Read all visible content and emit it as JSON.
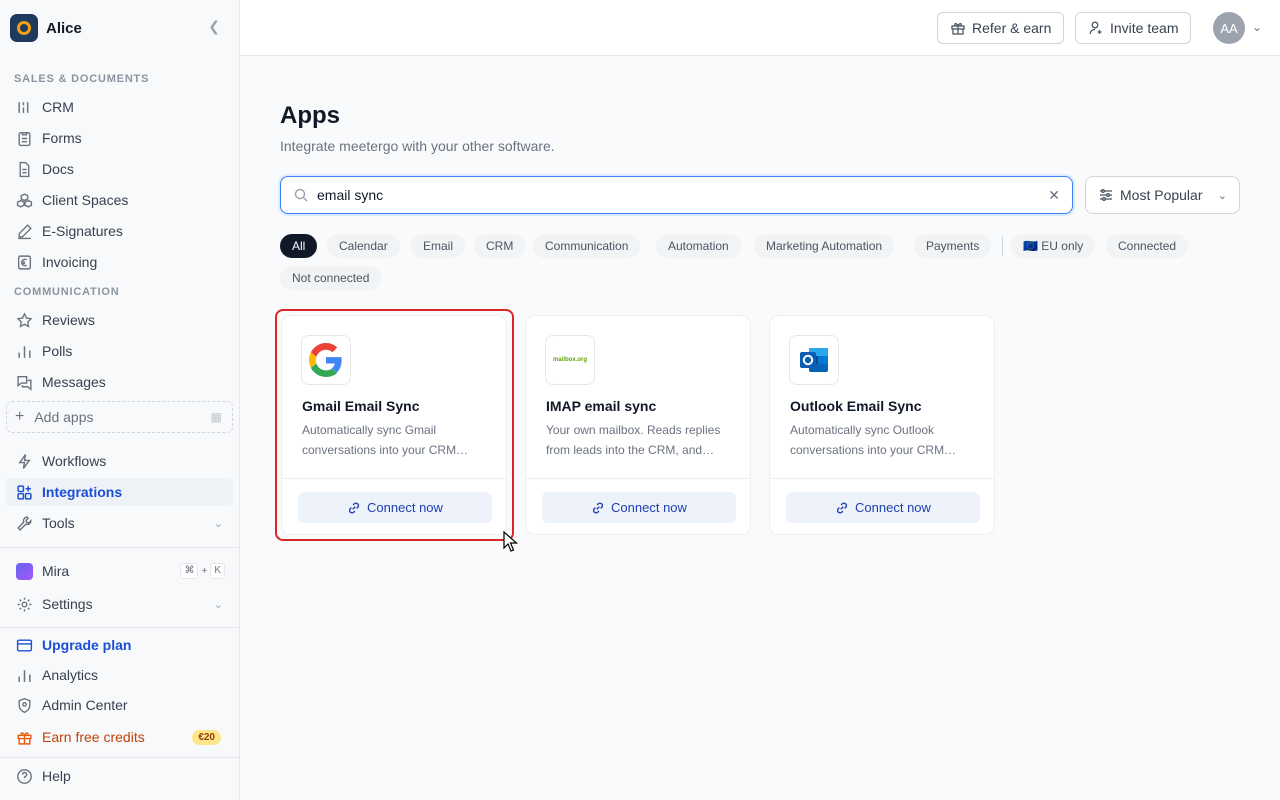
{
  "sidebar": {
    "workspace": "Alice",
    "section_sales": "SALES & DOCUMENTS",
    "section_comm": "COMMUNICATION",
    "items": {
      "crm": "CRM",
      "forms": "Forms",
      "docs": "Docs",
      "client_spaces": "Client Spaces",
      "esign": "E-Signatures",
      "invoicing": "Invoicing",
      "reviews": "Reviews",
      "polls": "Polls",
      "messages": "Messages",
      "add_apps": "Add apps",
      "workflows": "Workflows",
      "integrations": "Integrations",
      "tools": "Tools",
      "mira": "Mira",
      "settings": "Settings",
      "upgrade": "Upgrade plan",
      "analytics": "Analytics",
      "admin": "Admin Center",
      "earn": "Earn free credits",
      "help": "Help"
    },
    "shortcut_keys": [
      "⌘",
      "+",
      "K"
    ],
    "credit_badge": "€20"
  },
  "header": {
    "refer": "Refer & earn",
    "invite": "Invite team",
    "avatar": "AA"
  },
  "main": {
    "title": "Apps",
    "subtitle": "Integrate meetergo with your other software.",
    "search_value": "email sync",
    "sort_label": "Most Popular",
    "filters": [
      "All",
      "Calendar",
      "Email",
      "CRM",
      "Communication",
      "Automation",
      "Marketing Automation",
      "Payments",
      "🇪🇺 EU only",
      "Connected",
      "Not connected"
    ],
    "cards": [
      {
        "name": "Gmail Email Sync",
        "desc": "Automatically sync Gmail conversations into your CRM…",
        "button": "Connect now"
      },
      {
        "name": "IMAP email sync",
        "desc": "Your own mailbox. Reads replies from leads into the CRM, and…",
        "button": "Connect now",
        "logo_text": "mailbox.org"
      },
      {
        "name": "Outlook Email Sync",
        "desc": "Automatically sync Outlook conversations into your CRM…",
        "button": "Connect now"
      }
    ]
  },
  "colors": {
    "accent": "#2563eb",
    "highlight": "#dc2626",
    "earn": "#c2410c"
  }
}
